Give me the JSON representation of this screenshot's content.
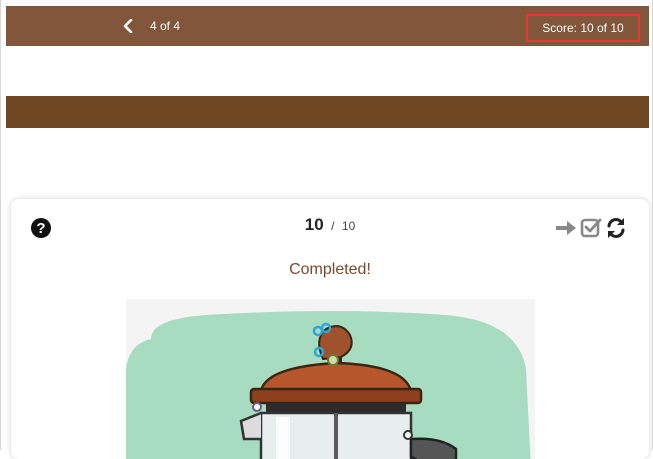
{
  "topbar": {
    "progress": "4 of 4",
    "score": "Score: 10 of 10"
  },
  "card": {
    "score_current": "10",
    "score_sep": "/",
    "score_total": "10",
    "status": "Completed!",
    "icons": [
      "help-icon",
      "arrow-right-icon",
      "check-square-icon",
      "refresh-icon"
    ]
  },
  "colors": {
    "topbar": "#82563a",
    "band": "#6f4622",
    "highlight": "#e53935",
    "status_text": "#7a4a2a",
    "illustration_bg": "#a8dcc1"
  }
}
